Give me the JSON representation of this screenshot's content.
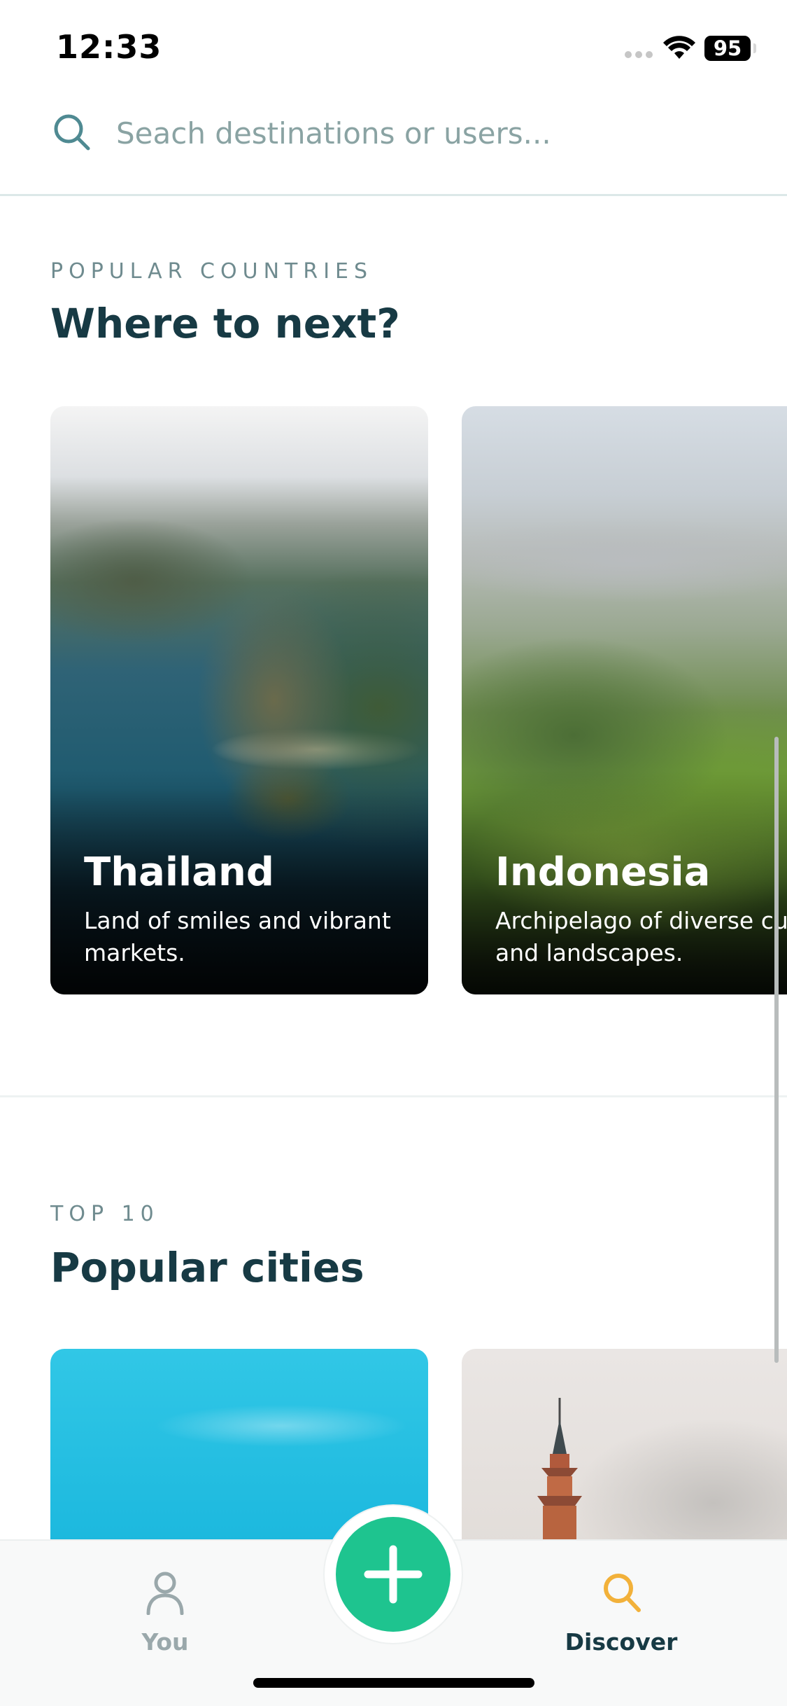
{
  "status_bar": {
    "time": "12:33",
    "battery": "95"
  },
  "search": {
    "placeholder": "Seach destinations or users..."
  },
  "countries_section": {
    "eyebrow": "POPULAR COUNTRIES",
    "title": "Where to next?",
    "cards": [
      {
        "name": "Thailand",
        "description": "Land of smiles and vibrant markets."
      },
      {
        "name": "Indonesia",
        "description": "Archipelago of diverse cultures and landscapes."
      }
    ]
  },
  "cities_section": {
    "eyebrow": "TOP 10",
    "title": "Popular cities"
  },
  "tab_bar": {
    "you_label": "You",
    "discover_label": "Discover",
    "active_tab": "Discover"
  },
  "colors": {
    "accent": "#1ec48f",
    "active_icon": "#f2b13a",
    "heading": "#173a44",
    "muted": "#6f8b8f"
  },
  "icons": {
    "search": "search-icon",
    "you": "person-icon",
    "add": "plus-icon",
    "discover": "search-icon"
  }
}
